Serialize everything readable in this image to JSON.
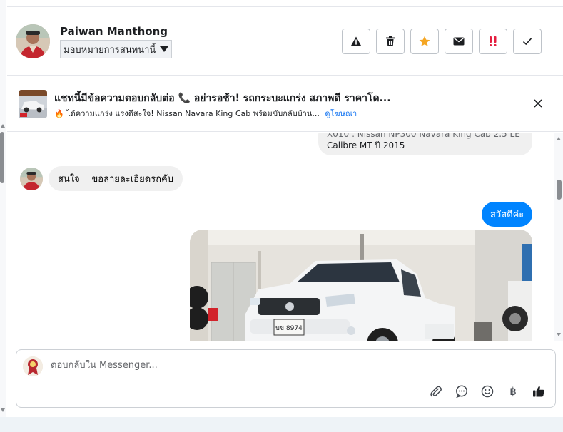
{
  "header": {
    "contact_name": "Paiwan Manthong",
    "assign_label": "มอบหมายการสนทนานี้",
    "actions": [
      {
        "name": "warning-icon",
        "color": "#1c1e21"
      },
      {
        "name": "trash-icon",
        "color": "#1c1e21"
      },
      {
        "name": "star-icon",
        "color": "#f5a623"
      },
      {
        "name": "envelope-icon",
        "color": "#1c1e21"
      },
      {
        "name": "double-exclamation-icon",
        "color": "#e41e3f"
      },
      {
        "name": "check-icon",
        "color": "#1c1e21"
      }
    ]
  },
  "ad": {
    "title": "แชทนี้มีข้อความตอบกลับต่อ 📞 อย่ารอช้า! รถกระบะแกร่ง สภาพดี ราคาโด...",
    "subtitle": "🔥 ได้ความแกร่ง แรงดีสะใจ! Nissan Navara King Cab พร้อมขับกลับบ้าน...",
    "link_label": "ดูโฆษณา"
  },
  "messages": {
    "top_partial_line1": "X010 : Nissan NP300 Navara King Cab 2.5 LE",
    "top_partial_line2": "Calibre MT ปี 2015",
    "incoming_1": "สนใจ    ขอลายละเอียดรถคับ",
    "outgoing_1": "สวัสดีค่ะ",
    "photo_plate": "บข 8974"
  },
  "composer": {
    "placeholder": "ตอบกลับใน Messenger...",
    "tools": [
      {
        "name": "paperclip-icon"
      },
      {
        "name": "chat-bubble-icon"
      },
      {
        "name": "emoji-icon"
      },
      {
        "name": "baht-icon",
        "glyph": "฿"
      },
      {
        "name": "thumbs-up-icon",
        "color": "#1c1e21"
      }
    ]
  },
  "colors": {
    "accent": "#0084ff",
    "link": "#1877f2",
    "border": "#ccd0d5"
  }
}
